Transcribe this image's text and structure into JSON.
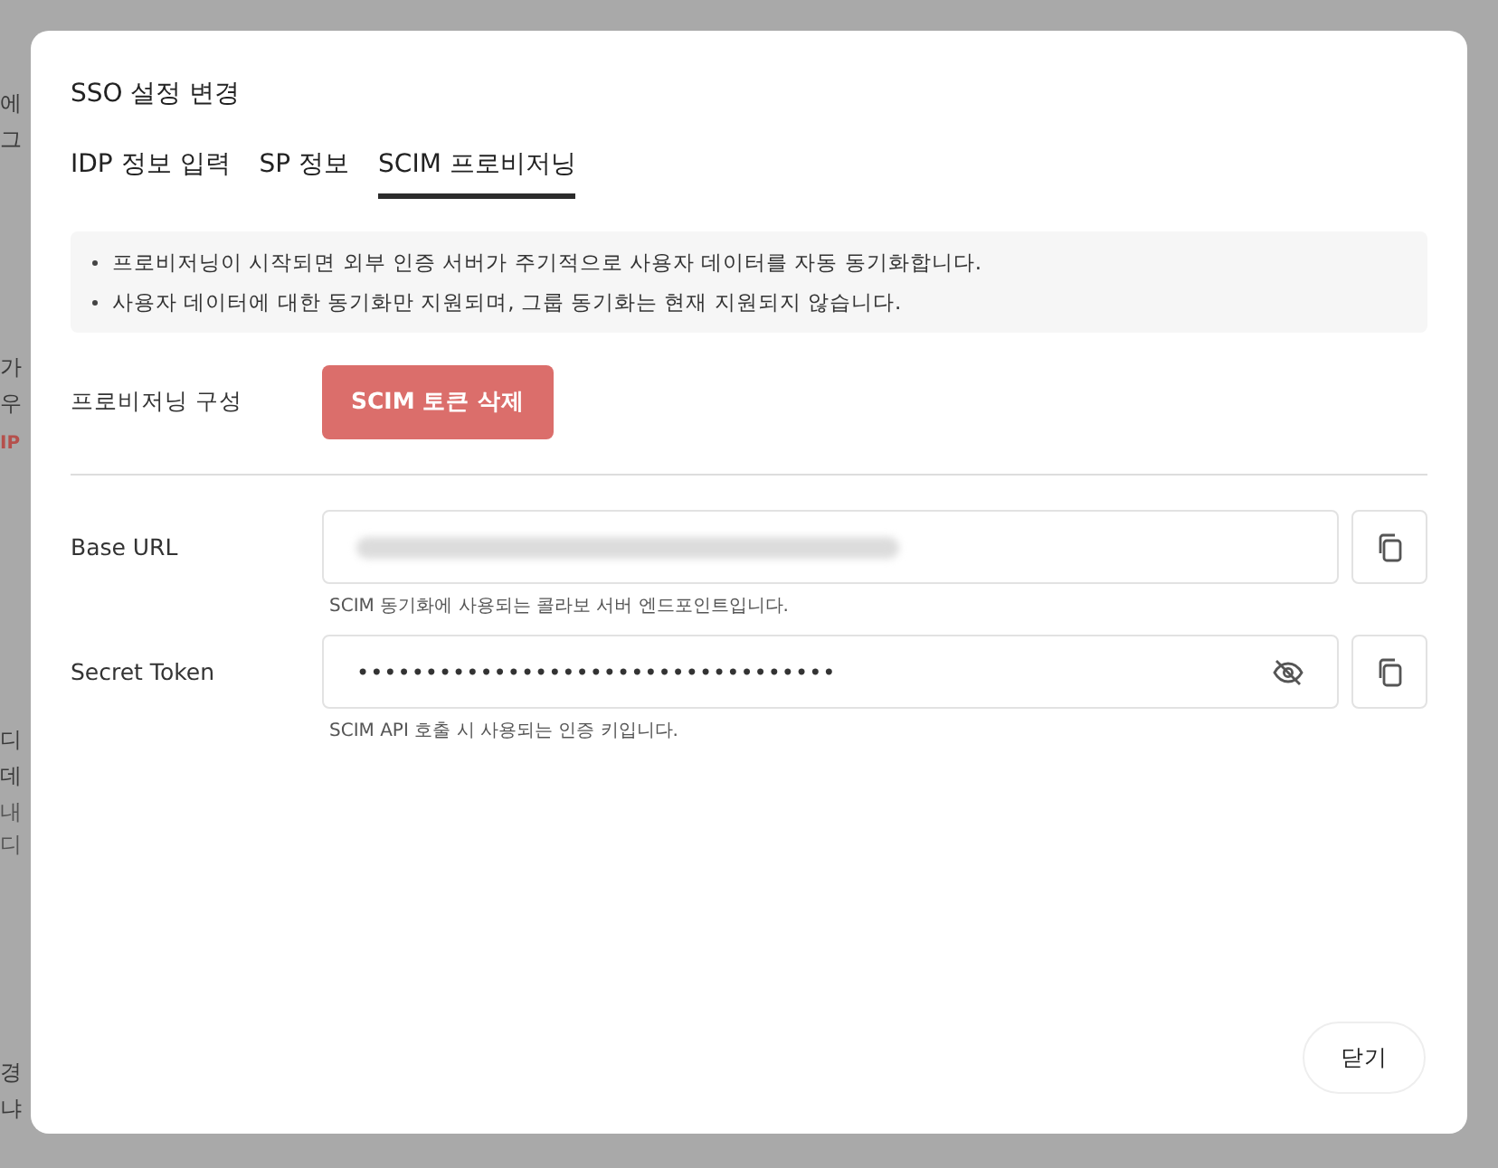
{
  "background_fragments": [
    {
      "text": "에",
      "kind": "plain"
    },
    {
      "text": "그",
      "kind": "plain"
    },
    {
      "text": "가",
      "kind": "plain"
    },
    {
      "text": "우",
      "kind": "plain"
    },
    {
      "text": "IP",
      "kind": "accent"
    },
    {
      "text": "디",
      "kind": "plain"
    },
    {
      "text": "데",
      "kind": "plain"
    },
    {
      "text": "내",
      "kind": "muted"
    },
    {
      "text": "디",
      "kind": "muted"
    },
    {
      "text": "경",
      "kind": "plain"
    },
    {
      "text": "냐",
      "kind": "plain"
    }
  ],
  "dialog": {
    "title": "SSO 설정 변경",
    "tabs": [
      {
        "label": "IDP 정보 입력",
        "selected": false
      },
      {
        "label": "SP 정보",
        "selected": false
      },
      {
        "label": "SCIM 프로비저닝",
        "selected": true
      }
    ],
    "notices": [
      "프로비저닝이 시작되면 외부 인증 서버가 주기적으로 사용자 데이터를 자동 동기화합니다.",
      "사용자 데이터에 대한 동기화만 지원되며, 그룹 동기화는 현재 지원되지 않습니다."
    ],
    "provisioning": {
      "label": "프로비저닝 구성",
      "button": "SCIM 토큰 삭제"
    },
    "fields": [
      {
        "label": "Base URL",
        "kind": "redacted",
        "help": "SCIM 동기화에 사용되는 콜라보 서버 엔드포인트입니다."
      },
      {
        "label": "Secret Token",
        "kind": "secret",
        "value": "•••••••••••••••••••••••••••••••••••",
        "help": "SCIM API 호출 시 사용되는 인증 키입니다."
      }
    ],
    "close_button": "닫기"
  }
}
